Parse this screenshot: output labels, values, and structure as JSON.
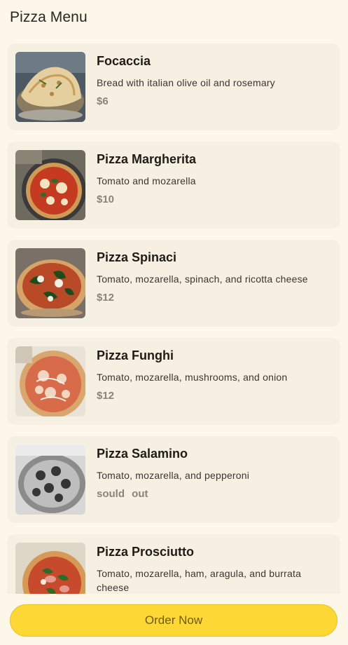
{
  "header": {
    "title": "Pizza Menu"
  },
  "menu": [
    {
      "name": "Focaccia",
      "description": "Bread with italian olive oil and rosemary",
      "price": "$6",
      "image": "focaccia-photo",
      "sold_out": false
    },
    {
      "name": "Pizza Margherita",
      "description": "Tomato and mozarella",
      "price": "$10",
      "image": "margherita-photo",
      "sold_out": false
    },
    {
      "name": "Pizza Spinaci",
      "description": "Tomato, mozarella, spinach, and ricotta cheese",
      "price": "$12",
      "image": "spinaci-photo",
      "sold_out": false
    },
    {
      "name": "Pizza Funghi",
      "description": "Tomato, mozarella, mushrooms, and onion",
      "price": "$12",
      "image": "funghi-photo",
      "sold_out": false
    },
    {
      "name": "Pizza Salamino",
      "description": "Tomato, mozarella, and pepperoni",
      "price": "sould out",
      "image": "salamino-photo",
      "sold_out": true
    },
    {
      "name": "Pizza Prosciutto",
      "description": "Tomato, mozarella, ham, aragula, and burrata cheese",
      "price": "",
      "image": "prosciutto-photo",
      "sold_out": false
    }
  ],
  "footer": {
    "order_label": "Order Now"
  },
  "colors": {
    "background": "#fdf7ea",
    "card": "#f6f0e3",
    "button": "#fdd835",
    "price": "#8a8378"
  }
}
